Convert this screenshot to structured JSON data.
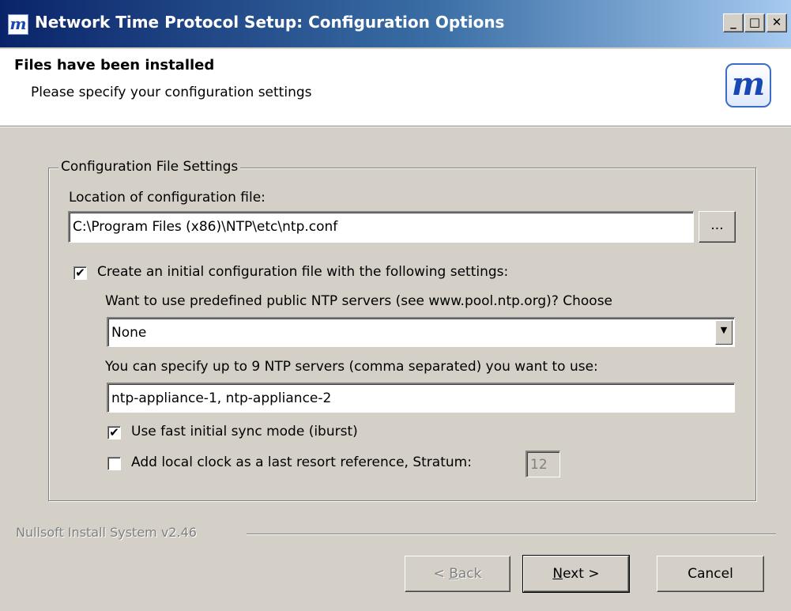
{
  "window": {
    "title": "Network Time Protocol Setup: Configuration Options",
    "icon_glyph": "m",
    "minimize_glyph": "_",
    "maximize_glyph": "□",
    "close_glyph": "✕"
  },
  "header": {
    "title": "Files have been installed",
    "subtitle": "Please specify your configuration settings",
    "logo_glyph": "m"
  },
  "group": {
    "label": "Configuration File Settings",
    "location_label": "Location of configuration file:",
    "location_value": "C:\\Program Files (x86)\\NTP\\etc\\ntp.conf",
    "browse_label": "...",
    "create_initial": {
      "checked": true,
      "label": "Create an initial configuration file with the following settings:"
    },
    "pool_label": "Want to use predefined public NTP servers (see www.pool.ntp.org)? Choose",
    "pool_selected": "None",
    "servers_label": "You can specify up to 9 NTP servers (comma separated) you want to use:",
    "servers_value": "ntp-appliance-1, ntp-appliance-2",
    "iburst": {
      "checked": true,
      "label": "Use fast initial sync mode (iburst)"
    },
    "local_clock": {
      "checked": false,
      "label": "Add local clock as a last resort reference, Stratum:",
      "stratum_value": "12"
    }
  },
  "footer": {
    "brand": "Nullsoft Install System v2.46",
    "back_pre": "< ",
    "back_key": "B",
    "back_post": "ack",
    "next_key": "N",
    "next_post": "ext >",
    "cancel_label": "Cancel"
  },
  "colors": {
    "titlebar_start": "#0a246a",
    "titlebar_end": "#a6caf0",
    "dialog_face": "#d4d0c8",
    "logo_blue": "#1947b4"
  },
  "icons": {
    "app": "nsis-m-icon",
    "logo": "nsis-m-logo",
    "dropdown": "chevron-down-icon",
    "check": "check-icon"
  }
}
